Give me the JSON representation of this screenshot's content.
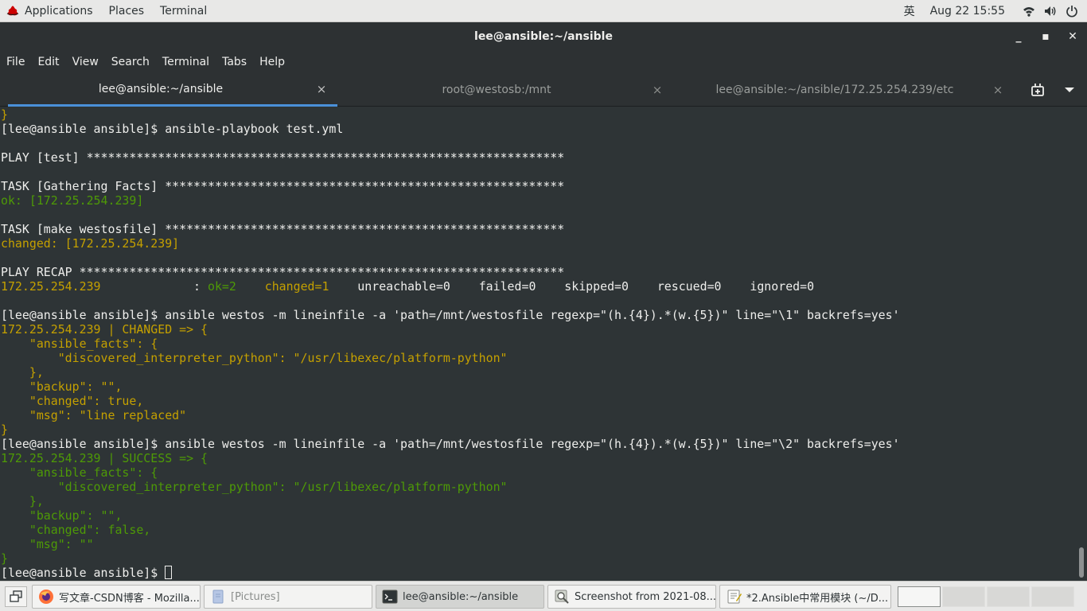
{
  "topbar": {
    "applications": "Applications",
    "places": "Places",
    "terminal": "Terminal",
    "ime": "英",
    "clock": "Aug 22  15:55",
    "icons": [
      "redhat-icon",
      "wifi-icon",
      "volume-icon",
      "power-icon"
    ]
  },
  "window": {
    "title": "lee@ansible:~/ansible",
    "minimize": "_",
    "maximize": "▪",
    "close": "✕"
  },
  "menu": [
    "File",
    "Edit",
    "View",
    "Search",
    "Terminal",
    "Tabs",
    "Help"
  ],
  "tabs": [
    {
      "label": "lee@ansible:~/ansible",
      "close": "×",
      "active": true
    },
    {
      "label": "root@westosb:/mnt",
      "close": "×",
      "active": false
    },
    {
      "label": "lee@ansible:~/ansible/172.25.254.239/etc",
      "close": "×",
      "active": false
    }
  ],
  "terminal": {
    "lines": [
      {
        "segments": [
          {
            "text": "}",
            "color": "yellow"
          }
        ]
      },
      {
        "segments": [
          {
            "text": "[lee@ansible ansible]$ ansible-playbook test.yml",
            "color": "default"
          }
        ]
      },
      {
        "segments": [
          {
            "text": "",
            "color": "default"
          }
        ]
      },
      {
        "segments": [
          {
            "text": "PLAY [test] *******************************************************************",
            "color": "default"
          }
        ]
      },
      {
        "segments": [
          {
            "text": "",
            "color": "default"
          }
        ]
      },
      {
        "segments": [
          {
            "text": "TASK [Gathering Facts] ********************************************************",
            "color": "default"
          }
        ]
      },
      {
        "segments": [
          {
            "text": "ok: [172.25.254.239]",
            "color": "green"
          }
        ]
      },
      {
        "segments": [
          {
            "text": "",
            "color": "default"
          }
        ]
      },
      {
        "segments": [
          {
            "text": "TASK [make westosfile] ********************************************************",
            "color": "default"
          }
        ]
      },
      {
        "segments": [
          {
            "text": "changed: [172.25.254.239]",
            "color": "yellow"
          }
        ]
      },
      {
        "segments": [
          {
            "text": "",
            "color": "default"
          }
        ]
      },
      {
        "segments": [
          {
            "text": "PLAY RECAP ********************************************************************",
            "color": "default"
          }
        ]
      },
      {
        "segments": [
          {
            "text": "172.25.254.239",
            "color": "yellow"
          },
          {
            "text": "             : ",
            "color": "default"
          },
          {
            "text": "ok=2",
            "color": "green"
          },
          {
            "text": "    ",
            "color": "default"
          },
          {
            "text": "changed=1",
            "color": "yellow"
          },
          {
            "text": "    unreachable=0    failed=0    skipped=0    rescued=0    ignored=0",
            "color": "default"
          }
        ]
      },
      {
        "segments": [
          {
            "text": "",
            "color": "default"
          }
        ]
      },
      {
        "segments": [
          {
            "text": "[lee@ansible ansible]$ ansible westos -m lineinfile -a 'path=/mnt/westosfile regexp=\"(h.{4}).*(w.{5})\" line=\"\\1\" backrefs=yes'",
            "color": "default"
          }
        ]
      },
      {
        "segments": [
          {
            "text": "172.25.254.239 | CHANGED => {",
            "color": "yellow"
          }
        ]
      },
      {
        "segments": [
          {
            "text": "    \"ansible_facts\": {",
            "color": "yellow"
          }
        ]
      },
      {
        "segments": [
          {
            "text": "        \"discovered_interpreter_python\": \"/usr/libexec/platform-python\"",
            "color": "yellow"
          }
        ]
      },
      {
        "segments": [
          {
            "text": "    },",
            "color": "yellow"
          }
        ]
      },
      {
        "segments": [
          {
            "text": "    \"backup\": \"\",",
            "color": "yellow"
          }
        ]
      },
      {
        "segments": [
          {
            "text": "    \"changed\": true,",
            "color": "yellow"
          }
        ]
      },
      {
        "segments": [
          {
            "text": "    \"msg\": \"line replaced\"",
            "color": "yellow"
          }
        ]
      },
      {
        "segments": [
          {
            "text": "}",
            "color": "yellow"
          }
        ]
      },
      {
        "segments": [
          {
            "text": "[lee@ansible ansible]$ ansible westos -m lineinfile -a 'path=/mnt/westosfile regexp=\"(h.{4}).*(w.{5})\" line=\"\\2\" backrefs=yes'",
            "color": "default"
          }
        ]
      },
      {
        "segments": [
          {
            "text": "172.25.254.239 | SUCCESS => {",
            "color": "green"
          }
        ]
      },
      {
        "segments": [
          {
            "text": "    \"ansible_facts\": {",
            "color": "green"
          }
        ]
      },
      {
        "segments": [
          {
            "text": "        \"discovered_interpreter_python\": \"/usr/libexec/platform-python\"",
            "color": "green"
          }
        ]
      },
      {
        "segments": [
          {
            "text": "    },",
            "color": "green"
          }
        ]
      },
      {
        "segments": [
          {
            "text": "    \"backup\": \"\",",
            "color": "green"
          }
        ]
      },
      {
        "segments": [
          {
            "text": "    \"changed\": false,",
            "color": "green"
          }
        ]
      },
      {
        "segments": [
          {
            "text": "    \"msg\": \"\"",
            "color": "green"
          }
        ]
      },
      {
        "segments": [
          {
            "text": "}",
            "color": "green"
          }
        ]
      },
      {
        "segments": [
          {
            "text": "[lee@ansible ansible]$ ",
            "color": "default"
          }
        ],
        "cursor": true
      }
    ],
    "colors": {
      "default": "#eeeeec",
      "yellow": "#c4a000",
      "green": "#4e9a06"
    }
  },
  "taskbar": {
    "tasks": [
      {
        "label": "写文章-CSDN博客 - Mozilla...",
        "icon": "firefox-icon",
        "state": "normal"
      },
      {
        "label": "[Pictures]",
        "icon": "folder-icon",
        "state": "dim"
      },
      {
        "label": "lee@ansible:~/ansible",
        "icon": "terminal-icon",
        "state": "active"
      },
      {
        "label": "Screenshot from 2021-08...",
        "icon": "image-viewer-icon",
        "state": "normal"
      },
      {
        "label": "*2.Ansible中常用模块 (~/D...",
        "icon": "text-editor-icon",
        "state": "normal"
      }
    ],
    "workspaces": 4,
    "current_workspace": 1
  }
}
